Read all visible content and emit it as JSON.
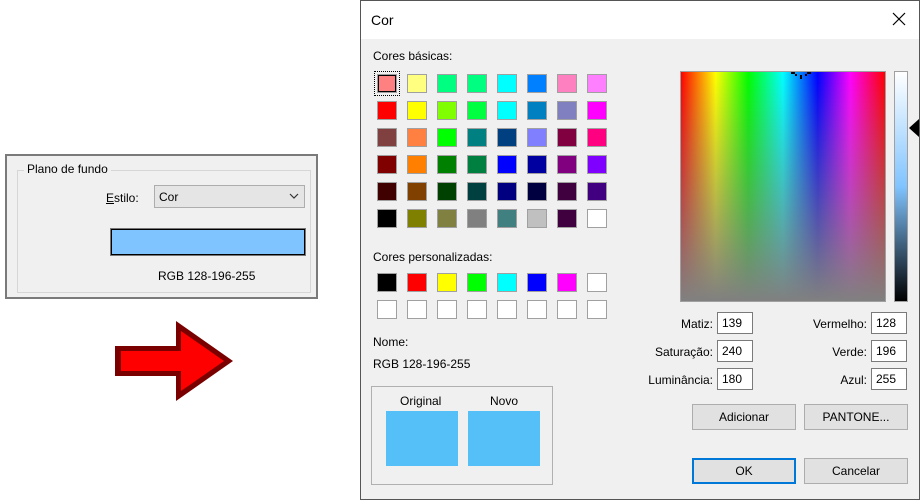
{
  "panel": {
    "group_title": "Plano de fundo",
    "estilo_label_u": "E",
    "estilo_label_rest": "stilo:",
    "style_value": "Cor",
    "swatch_color": "#80c4ff",
    "rgb_text": "RGB 128-196-255"
  },
  "dialog": {
    "title": "Cor",
    "basic_colors_label": "Cores básicas:",
    "basic_colors": [
      "#ff8080",
      "#ffff80",
      "#00ff80",
      "#00ff80",
      "#00ffff",
      "#0080ff",
      "#ff80c0",
      "#ff80ff",
      "#ff0000",
      "#ffff00",
      "#80ff00",
      "#00ff40",
      "#00ffff",
      "#0080c0",
      "#8080c0",
      "#ff00ff",
      "#804040",
      "#ff8040",
      "#00ff00",
      "#008080",
      "#004080",
      "#8080ff",
      "#800040",
      "#ff0080",
      "#800000",
      "#ff8000",
      "#008000",
      "#008040",
      "#0000ff",
      "#0000a0",
      "#800080",
      "#8000ff",
      "#400000",
      "#804000",
      "#004000",
      "#004040",
      "#000080",
      "#000040",
      "#400040",
      "#400080",
      "#000000",
      "#808000",
      "#808040",
      "#808080",
      "#408080",
      "#c0c0c0",
      "#400040",
      "#ffffff"
    ],
    "custom_colors_label": "Cores personalizadas:",
    "custom_colors": [
      "#000000",
      "#ff0000",
      "#ffff00",
      "#00ff00",
      "#00ffff",
      "#0000ff",
      "#ff00ff",
      "#ffffff",
      "#ffffff",
      "#ffffff",
      "#ffffff",
      "#ffffff",
      "#ffffff",
      "#ffffff",
      "#ffffff",
      "#ffffff"
    ],
    "name_label": "Nome:",
    "name_value": "RGB 128-196-255",
    "original_label": "Original",
    "novo_label": "Novo",
    "original_color": "#55c0f8",
    "novo_color": "#55c0f8",
    "matiz_label": "Matiz:",
    "matiz_value": "139",
    "saturacao_label": "Saturação:",
    "saturacao_value": "240",
    "luminancia_label": "Luminância:",
    "luminancia_value": "180",
    "vermelho_label": "Vermelho:",
    "vermelho_value": "128",
    "verde_label": "Verde:",
    "verde_value": "196",
    "azul_label": "Azul:",
    "azul_value": "255",
    "adicionar_label": "Adicionar",
    "pantone_label": "PANTONE...",
    "ok_label": "OK",
    "cancelar_label": "Cancelar"
  }
}
